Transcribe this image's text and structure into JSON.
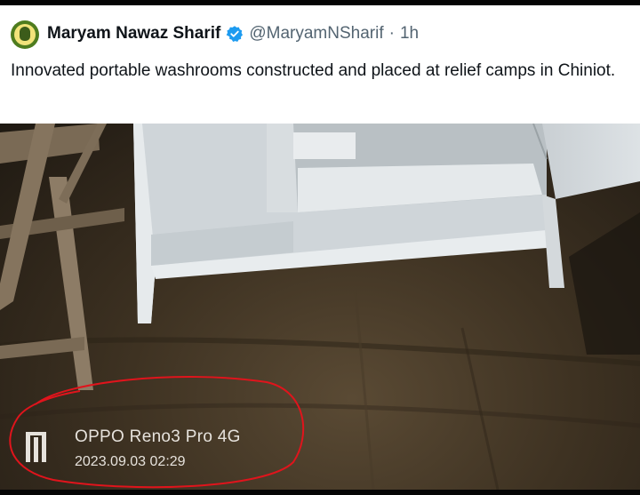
{
  "tweet": {
    "author_name": "Maryam Nawaz Sharif",
    "handle": "@MaryamNSharif",
    "separator": "·",
    "time": "1h",
    "text": "Innovated portable washrooms constructed and placed at relief camps in Chiniot.",
    "verified_icon": "verified-badge-icon",
    "avatar_icon": "profile-avatar"
  },
  "photo": {
    "description_icon": "washroom-photo",
    "watermark": {
      "logo_icon": "oppo-camera-watermark-icon",
      "device": "OPPO Reno3 Pro 4G",
      "timestamp": "2023.09.03 02:29"
    },
    "annotation_color": "#e0141c"
  },
  "colors": {
    "text_primary": "#0f1419",
    "text_secondary": "#536471",
    "verified_blue": "#1d9bf0"
  }
}
